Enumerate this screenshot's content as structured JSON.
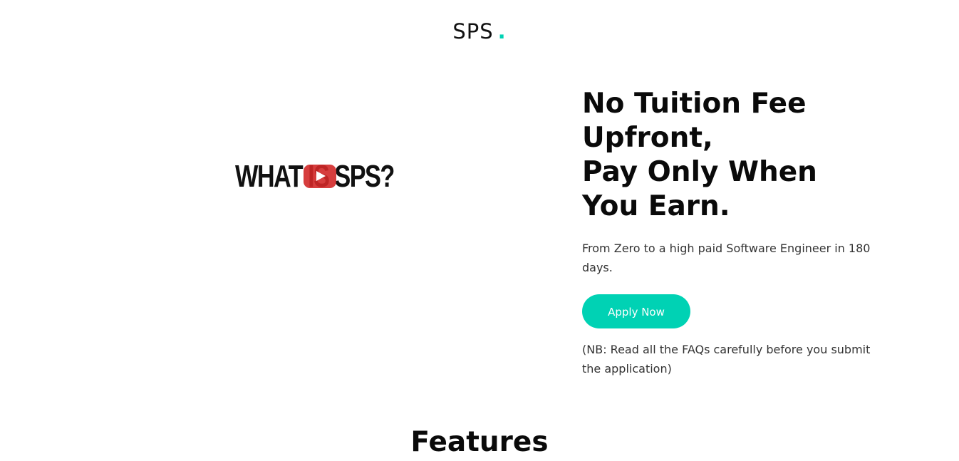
{
  "header": {
    "logo_text": "SPS",
    "logo_dot": "."
  },
  "hero": {
    "video": {
      "title": "WHAT IS SPS?",
      "play_icon": "youtube-play-icon"
    },
    "headline_lines": [
      "No Tuition Fee",
      "Upfront,",
      "Pay Only When",
      "You Earn."
    ],
    "subtext": "From Zero to a high paid Software Engineer in 180 days.",
    "apply_label": "Apply Now",
    "note": "(NB: Read all the FAQs carefully before you submit the application)"
  },
  "features": {
    "title": "Features"
  },
  "colors": {
    "accent": "#00d2b4",
    "text": "#111111",
    "background": "#ffffff"
  }
}
